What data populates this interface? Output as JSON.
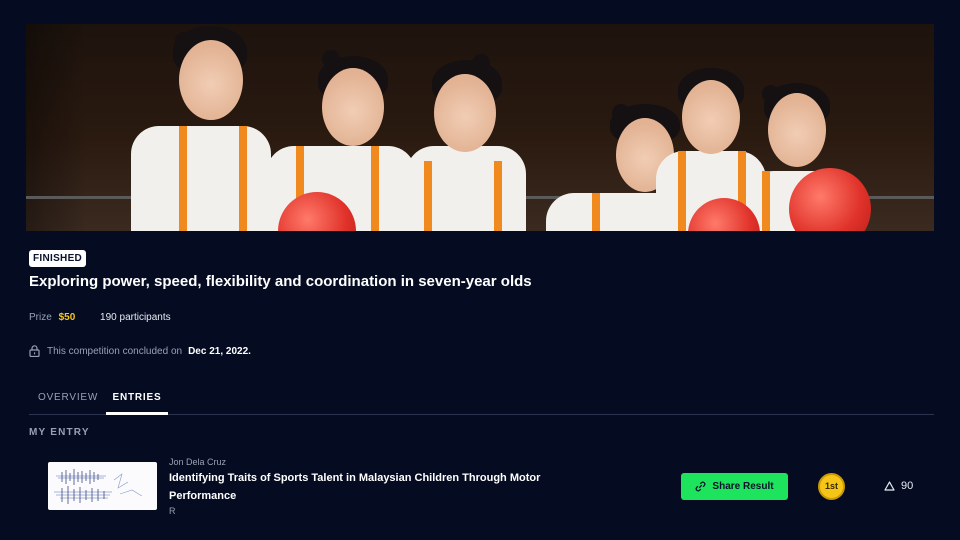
{
  "competition": {
    "status_badge": "FINISHED",
    "title": "Exploring power, speed, flexibility and coordination in seven-year olds",
    "prize_label": "Prize",
    "prize_value": "$50",
    "participants": "190 participants",
    "concluded_text": "This competition concluded on",
    "concluded_date": "Dec 21, 2022."
  },
  "tabs": [
    {
      "label": "OVERVIEW",
      "active": false
    },
    {
      "label": "ENTRIES",
      "active": true
    }
  ],
  "my_entry": {
    "section_label": "MY ENTRY",
    "author": "Jon Dela Cruz",
    "title": "Identifying Traits of Sports Talent in Malaysian Children Through Motor Performance",
    "subtitle": "R",
    "share_label": "Share Result",
    "rank": "1st",
    "votes": "90"
  },
  "colors": {
    "background": "#050c22",
    "prize": "#f5c518",
    "share_button": "#1ee35c",
    "medal": "#f5c518"
  },
  "icons": {
    "lock": "lock-icon",
    "share": "link-icon",
    "vote": "triangle-up-icon"
  }
}
